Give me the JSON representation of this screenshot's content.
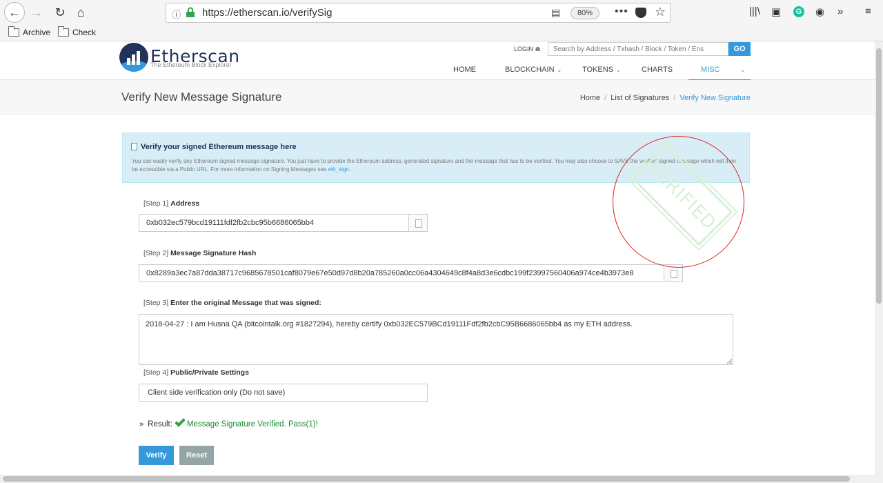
{
  "browser": {
    "url_scheme": "https://",
    "url_rest": "etherscan.io/verifySig",
    "zoom": "80%",
    "bookmarks": [
      "Archive",
      "Check"
    ]
  },
  "header": {
    "logo_name": "Etherscan",
    "logo_tagline": "The Ethereum Block Explorer",
    "login": "LOGIN",
    "search_placeholder": "Search by Address / Txhash / Block / Token / Ens",
    "go": "GO",
    "menu": [
      "HOME",
      "BLOCKCHAIN",
      "TOKENS",
      "CHARTS",
      "MISC"
    ]
  },
  "page": {
    "title": "Verify New Message Signature",
    "breadcrumb": [
      "Home",
      "List of Signatures",
      "Verify New Signature"
    ]
  },
  "info": {
    "title": "Verify your signed Ethereum message here",
    "text": "You can easily verify any Ethereum signed message signature. You just have to provide the Ethereum address, generated signature and the message that has to be verified. You may also choose to SAVE the verified signed message which will then be accessible via a Public URL. For more information on Signing Messages see ",
    "link": "eth_sign",
    "text_end": "."
  },
  "steps": {
    "s1_prefix": "[Step 1]",
    "s1_label": "Address",
    "s1_value": "0xb032ec579bcd19111fdf2fb2cbc95b6686065bb4",
    "s2_prefix": "[Step 2]",
    "s2_label": "Message Signature Hash",
    "s2_value": "0x8289a3ec7a87dda38717c9685678501caf8079e67e50d97d8b20a785260a0cc06a4304649c8f4a8d3e6cdbc199f23997560406a974ce4b3973e8",
    "s3_prefix": "[Step 3]",
    "s3_label": "Enter the original Message that was signed:",
    "s3_value": "2018-04-27 : I am Husna QA (bitcointalk.org #1827294), hereby certify 0xb032EC579BCd19111Fdf2fb2cbC95B6686065bb4 as my ETH address.",
    "s4_prefix": "[Step 4]",
    "s4_label": "Public/Private Settings",
    "s4_value": "Client side verification only (Do not save)"
  },
  "result": {
    "label": "Result:",
    "message": "Message Signature Verified. Pass(1)!"
  },
  "buttons": {
    "verify": "Verify",
    "reset": "Reset"
  },
  "stamp": {
    "text": "VERIFIED"
  },
  "colors": {
    "accent": "#3498db",
    "brand": "#21325b",
    "success": "#1b8a2f",
    "annotation": "#e02020"
  }
}
